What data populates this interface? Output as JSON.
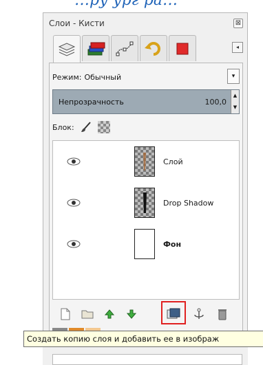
{
  "caption": "…ру ург ра…",
  "dock": {
    "title": "Слои - Кисти",
    "close_glyph": "⊠",
    "tabs": [
      {
        "name": "layers",
        "icon": "layers-icon"
      },
      {
        "name": "channels",
        "icon": "channels-icon"
      },
      {
        "name": "paths",
        "icon": "paths-icon"
      },
      {
        "name": "undo",
        "icon": "undo-history-icon"
      },
      {
        "name": "colors",
        "icon": "red-square-icon"
      }
    ],
    "tab_menu_glyph": "◂"
  },
  "layers_panel": {
    "mode_label": "Режим:",
    "mode_value": "Обычный",
    "dropdown_glyph": "▾",
    "opacity_label": "Непрозрачность",
    "opacity_value": "100,0",
    "lock_label": "Блок:",
    "layers": [
      {
        "name": "Слой",
        "thumb": "checkered",
        "visible": true,
        "bold": false
      },
      {
        "name": "Drop Shadow",
        "thumb": "checkered",
        "visible": true,
        "bold": false
      },
      {
        "name": "Фон",
        "thumb": "white",
        "visible": true,
        "bold": true
      }
    ],
    "toolbar": [
      {
        "name": "new-layer",
        "icon": "new-document-icon"
      },
      {
        "name": "new-layer-group",
        "icon": "folder-icon"
      },
      {
        "name": "raise-layer",
        "icon": "arrow-up-icon"
      },
      {
        "name": "lower-layer",
        "icon": "arrow-down-icon"
      },
      {
        "name": "duplicate-layer",
        "icon": "duplicate-icon"
      },
      {
        "name": "anchor-layer",
        "icon": "anchor-icon"
      },
      {
        "name": "delete-layer",
        "icon": "trash-icon"
      }
    ]
  },
  "tooltip": "Создать копию слоя и добавить ее в изображ",
  "colors": {
    "accent_red": "#e02020",
    "opacity_bar": "#9daab4",
    "tooltip_bg": "#ffffe1"
  }
}
